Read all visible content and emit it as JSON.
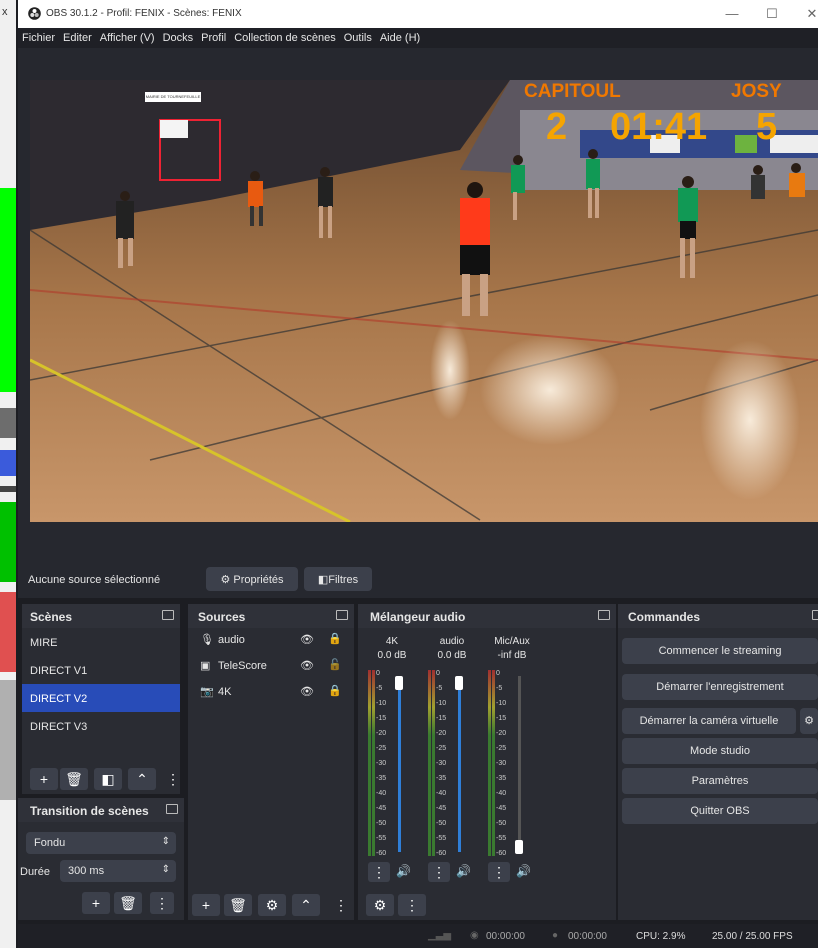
{
  "window": {
    "title": "OBS 30.1.2 - Profil: FENIX - Scènes: FENIX",
    "minimize": "—",
    "maximize": "☐",
    "close": "✕",
    "left_close": "x"
  },
  "menu": [
    "Fichier",
    "Editer",
    "Afficher (V)",
    "Docks",
    "Profil",
    "Collection de scènes",
    "Outils",
    "Aide (H)"
  ],
  "scoreboard": {
    "home_team": "CAPITOUL",
    "away_team": "JOSY",
    "home_score": "2",
    "away_score": "5",
    "clock": "01:41",
    "banner": "MAIRIE DE TOURNEFEUILLE"
  },
  "source_toolbar": {
    "status": "Aucune source sélectionné",
    "properties": "Propriétés",
    "filters": "Filtres"
  },
  "scenes": {
    "title": "Scènes",
    "items": [
      "MIRE",
      "DIRECT V1",
      "DIRECT V2",
      "DIRECT V3"
    ],
    "selected": 2
  },
  "sources": {
    "title": "Sources",
    "items": [
      {
        "name": "audio",
        "icon": "microphone-icon"
      },
      {
        "name": "TeleScore",
        "icon": "window-icon"
      },
      {
        "name": "4K",
        "icon": "camera-icon"
      }
    ]
  },
  "mixer": {
    "title": "Mélangeur audio",
    "channels": [
      {
        "name": "4K",
        "db": "0.0 dB",
        "level": 0.0
      },
      {
        "name": "audio",
        "db": "0.0 dB",
        "level": 0.0
      },
      {
        "name": "Mic/Aux",
        "db": "-inf dB",
        "level": 1.0
      }
    ],
    "scale": [
      "0",
      "-5",
      "-10",
      "-15",
      "-20",
      "-25",
      "-30",
      "-35",
      "-40",
      "-45",
      "-50",
      "-55",
      "-60"
    ]
  },
  "transition": {
    "title": "Transition de scènes",
    "type": "Fondu",
    "duration_label": "Durée",
    "duration": "300 ms"
  },
  "controls": {
    "title": "Commandes",
    "buttons": [
      "Commencer le streaming",
      "Démarrer l'enregistrement",
      "Démarrer la caméra virtuelle",
      "Mode studio",
      "Paramètres",
      "Quitter OBS"
    ]
  },
  "status": {
    "stream_time": "00:00:00",
    "rec_time": "00:00:00",
    "cpu": "CPU: 2.9%",
    "fps": "25.00 / 25.00 FPS"
  },
  "colors": {
    "accent": "#284cb8",
    "panel": "#2a2c33",
    "bg": "#1c1d22",
    "score": "#f5a400",
    "team": "#f07800"
  }
}
